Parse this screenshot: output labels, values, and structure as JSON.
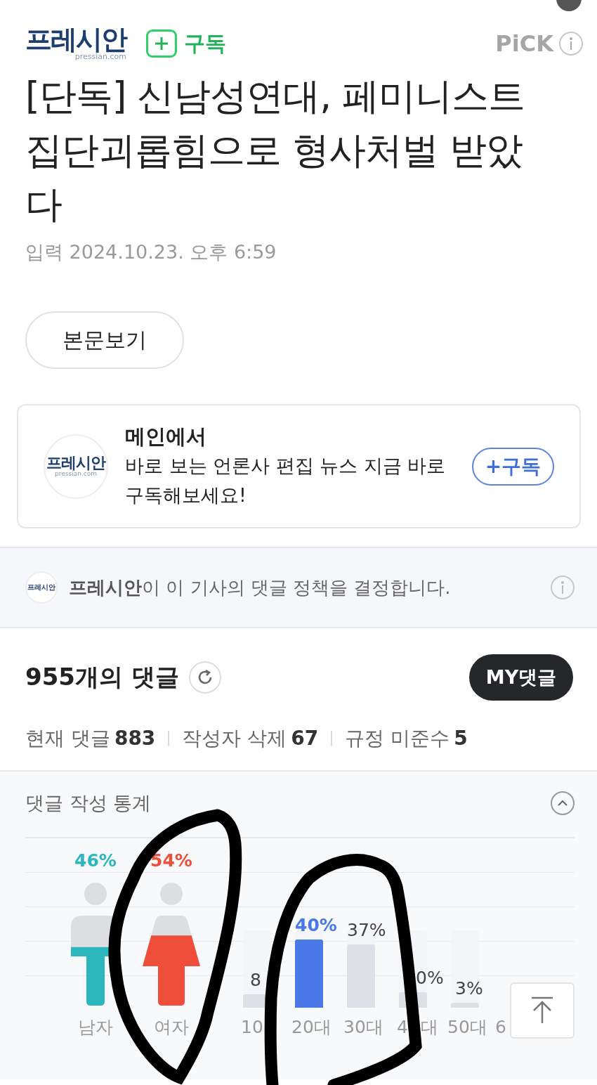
{
  "header": {
    "logo": "프레시안",
    "logo_domain": "pressian.com",
    "subscribe_label": "구독",
    "pick_label": "PiCK"
  },
  "article": {
    "title": "[단독] 신남성연대, 페미니스트 집단괴롭힘으로 형사처벌 받았다",
    "date": "입력 2024.10.23. 오후 6:59",
    "view_button": "본문보기"
  },
  "promo": {
    "logo": "프레시안",
    "logo_domain": "pressian.com",
    "heading": "메인에서",
    "text": "바로 보는 언론사 편집 뉴스 지금 바로 구독해보세요!",
    "button": "+구독"
  },
  "policy": {
    "logo": "프레시안",
    "press": "프레시안",
    "text": "이 이 기사의 댓글 정책을 결정합니다."
  },
  "comments": {
    "title": "955개의 댓글",
    "my_button": "MY댓글",
    "counts": [
      {
        "label": "현재 댓글",
        "value": "883"
      },
      {
        "label": "작성자 삭제",
        "value": "67"
      },
      {
        "label": "규정 미준수",
        "value": "5"
      }
    ]
  },
  "stats": {
    "title": "댓글 작성 통계",
    "expanded": true,
    "gender": [
      {
        "kind": "male",
        "percent": "46%",
        "label": "남자",
        "level": 0.65,
        "color": "#2bb7bd"
      },
      {
        "kind": "female",
        "percent": "54%",
        "label": "여자",
        "level": 0.78,
        "color": "#ee4e3a"
      }
    ],
    "ages": [
      {
        "percent": "8",
        "label": "10",
        "level": 0.17,
        "selected": false
      },
      {
        "percent": "40%",
        "label": "20대",
        "level": 0.88,
        "selected": true
      },
      {
        "percent": "37%",
        "label": "30대",
        "level": 0.82,
        "selected": false
      },
      {
        "percent": "0%",
        "label": "4 대",
        "level": 0.2,
        "selected": false
      },
      {
        "percent": "3%",
        "label": "50대",
        "level": 0.06,
        "selected": false
      },
      {
        "label": "6"
      }
    ]
  }
}
